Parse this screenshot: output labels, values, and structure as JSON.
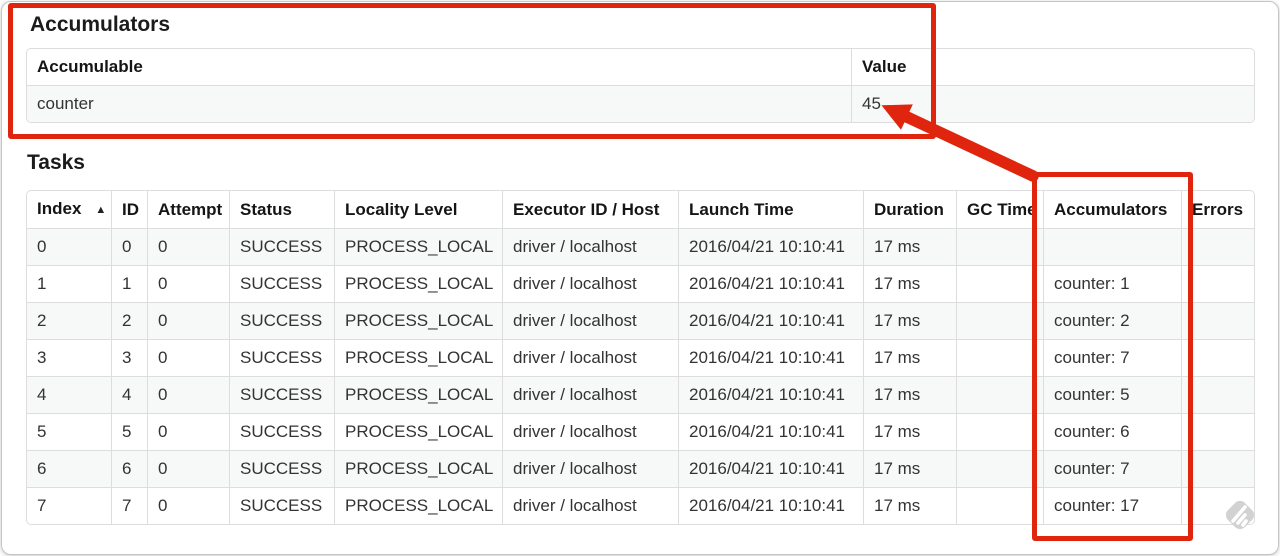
{
  "annotation": {
    "color": "#e0250f"
  },
  "icons": {
    "sort_ascending": "▲",
    "watermark": "feedly-logo"
  },
  "accumulators_section": {
    "title": "Accumulators",
    "table": {
      "columns": [
        "Accumulable",
        "Value"
      ],
      "column_keys": [
        "accumulable",
        "value"
      ],
      "rows": [
        [
          "counter",
          "45"
        ]
      ]
    }
  },
  "tasks_section": {
    "title": "Tasks",
    "table": {
      "columns": [
        "Index",
        "ID",
        "Attempt",
        "Status",
        "Locality Level",
        "Executor ID / Host",
        "Launch Time",
        "Duration",
        "GC Time",
        "Accumulators",
        "Errors"
      ],
      "column_keys": [
        "index",
        "id",
        "attempt",
        "status",
        "locality_level",
        "executor_id_host",
        "launch_time",
        "duration",
        "gc_time",
        "accumulators",
        "errors"
      ],
      "sort_icon": "▲",
      "sorted_column": "Index",
      "rows": [
        [
          "0",
          "0",
          "0",
          "SUCCESS",
          "PROCESS_LOCAL",
          "driver / localhost",
          "2016/04/21 10:10:41",
          "17 ms",
          "",
          "",
          ""
        ],
        [
          "1",
          "1",
          "0",
          "SUCCESS",
          "PROCESS_LOCAL",
          "driver / localhost",
          "2016/04/21 10:10:41",
          "17 ms",
          "",
          "counter: 1",
          ""
        ],
        [
          "2",
          "2",
          "0",
          "SUCCESS",
          "PROCESS_LOCAL",
          "driver / localhost",
          "2016/04/21 10:10:41",
          "17 ms",
          "",
          "counter: 2",
          ""
        ],
        [
          "3",
          "3",
          "0",
          "SUCCESS",
          "PROCESS_LOCAL",
          "driver / localhost",
          "2016/04/21 10:10:41",
          "17 ms",
          "",
          "counter: 7",
          ""
        ],
        [
          "4",
          "4",
          "0",
          "SUCCESS",
          "PROCESS_LOCAL",
          "driver / localhost",
          "2016/04/21 10:10:41",
          "17 ms",
          "",
          "counter: 5",
          ""
        ],
        [
          "5",
          "5",
          "0",
          "SUCCESS",
          "PROCESS_LOCAL",
          "driver / localhost",
          "2016/04/21 10:10:41",
          "17 ms",
          "",
          "counter: 6",
          ""
        ],
        [
          "6",
          "6",
          "0",
          "SUCCESS",
          "PROCESS_LOCAL",
          "driver / localhost",
          "2016/04/21 10:10:41",
          "17 ms",
          "",
          "counter: 7",
          ""
        ],
        [
          "7",
          "7",
          "0",
          "SUCCESS",
          "PROCESS_LOCAL",
          "driver / localhost",
          "2016/04/21 10:10:41",
          "17 ms",
          "",
          "counter: 17",
          ""
        ]
      ]
    }
  }
}
